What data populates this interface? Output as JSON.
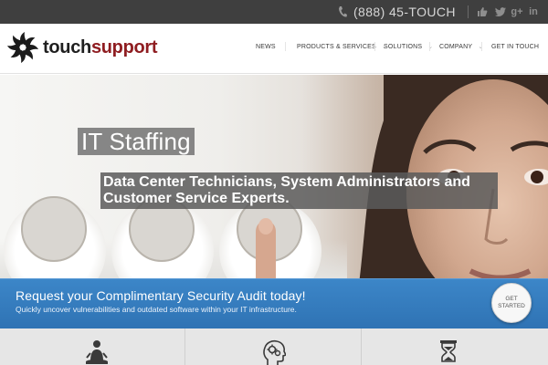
{
  "topbar": {
    "phone": "(888) 45-TOUCH",
    "icons": [
      "phone-icon",
      "facebook-like-icon",
      "twitter-icon",
      "google-plus-icon",
      "linkedin-icon"
    ],
    "social": {
      "gplus": "g+",
      "linkedin": "in"
    }
  },
  "header": {
    "logo": {
      "part1": "touch",
      "part2": "support"
    },
    "nav": [
      {
        "label": "NEWS"
      },
      {
        "label": "PRODUCTS & SERVICES"
      },
      {
        "label": "SOLUTIONS"
      },
      {
        "label": "COMPANY"
      },
      {
        "label": "GET IN TOUCH"
      }
    ]
  },
  "hero": {
    "title": "IT Staffing",
    "subtitle": "Data Center Technicians, System Administrators and Customer Service Experts."
  },
  "banner": {
    "title": "Request your Complimentary Security Audit today!",
    "subtitle": "Quickly uncover vulnerabilities and outdated software within your IT infrastructure.",
    "cta_line1": "GET",
    "cta_line2": "STARTED"
  },
  "features": {
    "icons": [
      "meditation-person-icon",
      "head-gears-icon",
      "hourglass-icon"
    ]
  },
  "colors": {
    "topbar": "#3f3f3f",
    "brand_red": "#8f1d21",
    "banner_blue": "#3580c2",
    "features_bg": "#e6e6e6"
  }
}
